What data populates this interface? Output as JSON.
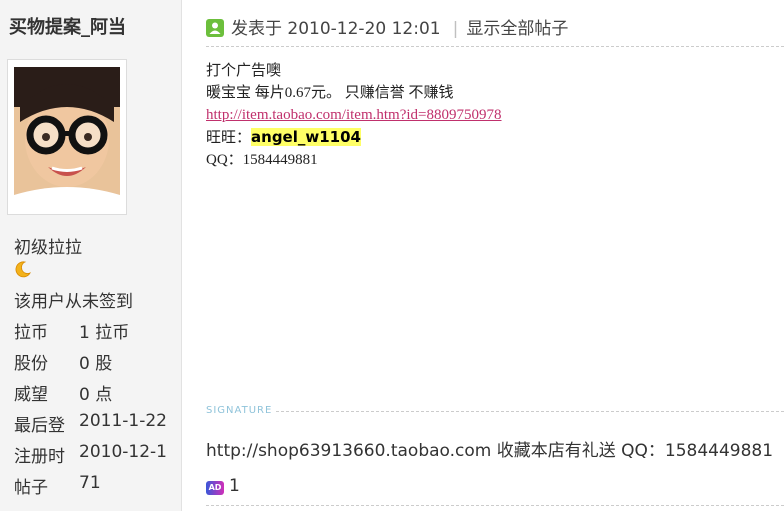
{
  "user": {
    "name": "买物提案_阿当",
    "rank": "初级拉拉",
    "rank_icon": "crescent-moon-icon",
    "signin_status": "该用户从未签到",
    "stats": [
      {
        "label": "拉币",
        "value": "1 拉币"
      },
      {
        "label": "股份",
        "value": "0 股"
      },
      {
        "label": "威望",
        "value": "0 点"
      },
      {
        "label": "最后登",
        "value": "2011-1-22"
      },
      {
        "label": "注册时",
        "value": "2010-12-1"
      },
      {
        "label": "帖子",
        "value": "71"
      }
    ]
  },
  "post": {
    "icon": "online-status-icon",
    "posted_label": "发表于 2010-12-20 12:01",
    "show_all": "显示全部帖子",
    "lines": [
      "打个广告噢",
      "暖宝宝 每片0.67元。 只赚信誉 不赚钱"
    ],
    "link": "http://item.taobao.com/item.htm?id=8809750978",
    "wangwang_label": "旺旺：",
    "wangwang_id": "angel_w1104",
    "qq_line": "QQ：1584449881"
  },
  "signature": {
    "label": "SIGNATURE",
    "text": "http://shop63913660.taobao.com 收藏本店有礼送 QQ：1584449881"
  },
  "ad": {
    "icon_text": "AD",
    "count": "1"
  },
  "colors": {
    "sidebar_bg": "#f4f4f4",
    "link": "#c0306c",
    "highlight": "#ffff66",
    "signature_label": "#8fc3da"
  }
}
